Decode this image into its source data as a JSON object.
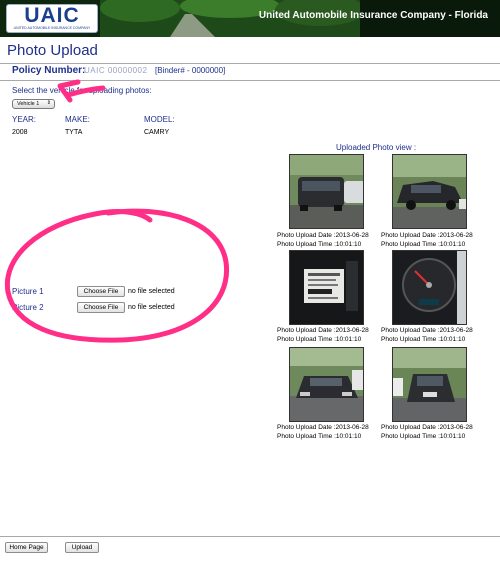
{
  "header": {
    "logo_text": "UAIC",
    "logo_subtext": "UNITED AUTOMOBILE INSURANCE COMPANY",
    "company_name": "United Automobile Insurance Company - Florida"
  },
  "page": {
    "title": "Photo Upload"
  },
  "policy": {
    "label": "Policy Number:",
    "number_redacted": "UAIC 00000002",
    "binder_text": "[Binder# - 0000000]"
  },
  "vehicle_select": {
    "label": "Select the vehicle for uploading photos:",
    "selected": "Vehicle 1"
  },
  "vehicle_info": {
    "headers": [
      "YEAR:",
      "MAKE:",
      "MODEL:"
    ],
    "values": [
      "2008",
      "TYTA",
      "CAMRY"
    ]
  },
  "uploads": [
    {
      "label": "Picture 1",
      "button": "Choose File",
      "status": "no file selected"
    },
    {
      "label": "Picture 2",
      "button": "Choose File",
      "status": "no file selected"
    }
  ],
  "photo_view": {
    "title": "Uploaded Photo view :",
    "photos": [
      {
        "date": "Photo Upload Date :2013-06-28",
        "time": "Photo Upload Time :10:01:10",
        "subject": "car-rear"
      },
      {
        "date": "Photo Upload Date :2013-06-28",
        "time": "Photo Upload Time :10:01:10",
        "subject": "car-side"
      },
      {
        "date": "Photo Upload Date :2013-06-28",
        "time": "Photo Upload Time :10:01:10",
        "subject": "vin-label"
      },
      {
        "date": "Photo Upload Date :2013-06-28",
        "time": "Photo Upload Time :10:01:10",
        "subject": "odometer"
      },
      {
        "date": "Photo Upload Date :2013-06-28",
        "time": "Photo Upload Time :10:01:10",
        "subject": "car-front"
      },
      {
        "date": "Photo Upload Date :2013-06-28",
        "time": "Photo Upload Time :10:01:10",
        "subject": "car-front-angle"
      }
    ]
  },
  "footer": {
    "home_button": "Home Page",
    "upload_button": "Upload"
  },
  "colors": {
    "title_blue": "#1f2f8c",
    "annotation_pink": "#ff2f87",
    "header_dark": "#0b1f0b"
  }
}
